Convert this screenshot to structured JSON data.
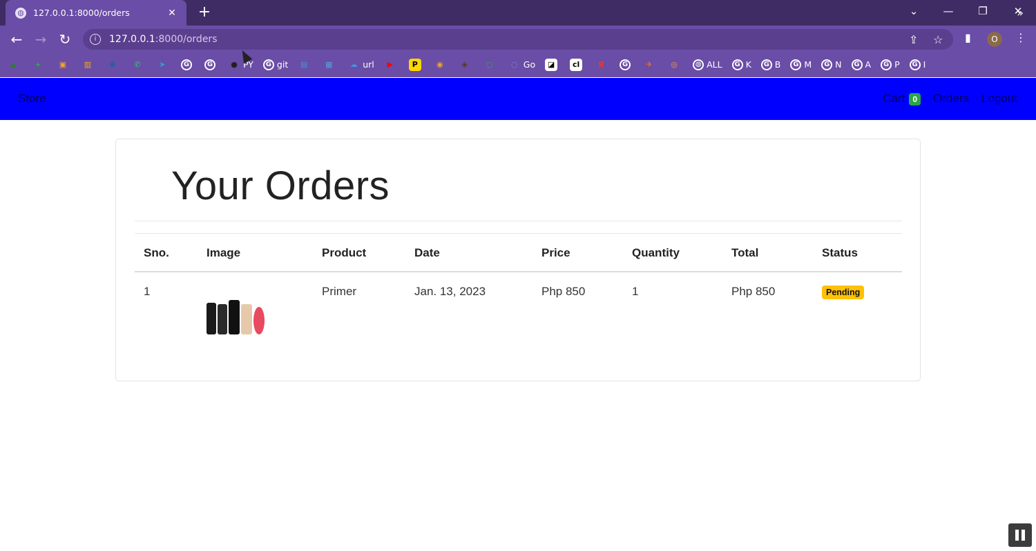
{
  "browser": {
    "tab_title": "127.0.0.1:8000/orders",
    "new_tab_label": "+",
    "url_host": "127.0.0.1",
    "url_path": ":8000/orders",
    "profile_initial": "O",
    "bookmarks": [
      {
        "icon": "drive-icon",
        "label": "",
        "color": "#2e7d32"
      },
      {
        "icon": "plus-app-icon",
        "label": "",
        "color": "#34a853"
      },
      {
        "icon": "cert-icon",
        "label": "",
        "color": "#f4a428"
      },
      {
        "icon": "bars-icon",
        "label": "",
        "color": "#f9ab00"
      },
      {
        "icon": "ieee-icon",
        "label": "",
        "color": "#1a5ca8"
      },
      {
        "icon": "whatsapp-icon",
        "label": "",
        "color": "#25d366"
      },
      {
        "icon": "telegram-icon",
        "label": "",
        "color": "#2aa3df"
      },
      {
        "icon": "google-icon",
        "label": "",
        "color": "#ffffff"
      },
      {
        "icon": "google-icon",
        "label": "",
        "color": "#ffffff"
      },
      {
        "icon": "github-icon",
        "label": "PY",
        "color": "#222222"
      },
      {
        "icon": "google-icon",
        "label": "git",
        "color": "#ffffff"
      },
      {
        "icon": "app-icon",
        "label": "",
        "color": "#4a90d9"
      },
      {
        "icon": "store-icon",
        "label": "",
        "color": "#5b9bd5"
      },
      {
        "icon": "cloud-icon",
        "label": "url",
        "color": "#4a90d9"
      },
      {
        "icon": "youtube-icon",
        "label": "",
        "color": "#ff0000"
      },
      {
        "icon": "p-icon",
        "label": "",
        "color": "#ffd600"
      },
      {
        "icon": "camera-icon",
        "label": "",
        "color": "#f4a428"
      },
      {
        "icon": "badge-icon",
        "label": "",
        "color": "#5a3a1a"
      },
      {
        "icon": "ring-icon",
        "label": "",
        "color": "#34a853"
      },
      {
        "icon": "swirl-icon",
        "label": "Go",
        "color": "#7aa7e0"
      },
      {
        "icon": "doc-icon",
        "label": "",
        "color": "#ffffff"
      },
      {
        "icon": "cl-icon",
        "label": "",
        "color": "#111111"
      },
      {
        "icon": "yandex-icon",
        "label": "",
        "color": "#e53935"
      },
      {
        "icon": "google-icon",
        "label": "",
        "color": "#ffffff"
      },
      {
        "icon": "bird-icon",
        "label": "",
        "color": "#f57c00"
      },
      {
        "icon": "eye-icon",
        "label": "",
        "color": "#f4a428"
      },
      {
        "icon": "globe-icon",
        "label": "ALL",
        "color": "#ffffff"
      },
      {
        "icon": "google-icon",
        "label": "K",
        "color": "#ffffff"
      },
      {
        "icon": "google-icon",
        "label": "B",
        "color": "#ffffff"
      },
      {
        "icon": "google-icon",
        "label": "M",
        "color": "#ffffff"
      },
      {
        "icon": "google-icon",
        "label": "N",
        "color": "#ffffff"
      },
      {
        "icon": "google-icon",
        "label": "A",
        "color": "#ffffff"
      },
      {
        "icon": "google-icon",
        "label": "P",
        "color": "#ffffff"
      },
      {
        "icon": "google-icon",
        "label": "I",
        "color": "#ffffff"
      }
    ],
    "bookmarks_more": "»"
  },
  "nav": {
    "brand": "Store",
    "cart_label": "Cart",
    "cart_count": "0",
    "orders_label": "Orders",
    "logout_label": "Logout",
    "bar_color": "#0000ff"
  },
  "page": {
    "title": "Your Orders"
  },
  "table": {
    "headers": [
      "Sno.",
      "Image",
      "Product",
      "Date",
      "Price",
      "Quantity",
      "Total",
      "Status"
    ],
    "rows": [
      {
        "sno": "1",
        "product": "Primer",
        "date": "Jan. 13, 2023",
        "price": "Php 850",
        "quantity": "1",
        "total": "Php 850",
        "status": "Pending"
      }
    ]
  }
}
